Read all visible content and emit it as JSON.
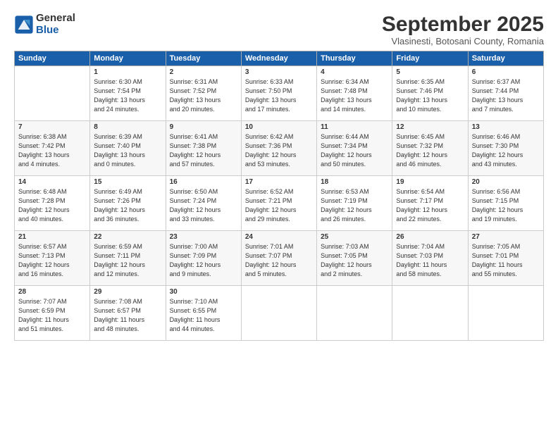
{
  "logo": {
    "general": "General",
    "blue": "Blue"
  },
  "title": "September 2025",
  "location": "Vlasinesti, Botosani County, Romania",
  "headers": [
    "Sunday",
    "Monday",
    "Tuesday",
    "Wednesday",
    "Thursday",
    "Friday",
    "Saturday"
  ],
  "weeks": [
    [
      {
        "day": "",
        "info": ""
      },
      {
        "day": "1",
        "info": "Sunrise: 6:30 AM\nSunset: 7:54 PM\nDaylight: 13 hours\nand 24 minutes."
      },
      {
        "day": "2",
        "info": "Sunrise: 6:31 AM\nSunset: 7:52 PM\nDaylight: 13 hours\nand 20 minutes."
      },
      {
        "day": "3",
        "info": "Sunrise: 6:33 AM\nSunset: 7:50 PM\nDaylight: 13 hours\nand 17 minutes."
      },
      {
        "day": "4",
        "info": "Sunrise: 6:34 AM\nSunset: 7:48 PM\nDaylight: 13 hours\nand 14 minutes."
      },
      {
        "day": "5",
        "info": "Sunrise: 6:35 AM\nSunset: 7:46 PM\nDaylight: 13 hours\nand 10 minutes."
      },
      {
        "day": "6",
        "info": "Sunrise: 6:37 AM\nSunset: 7:44 PM\nDaylight: 13 hours\nand 7 minutes."
      }
    ],
    [
      {
        "day": "7",
        "info": "Sunrise: 6:38 AM\nSunset: 7:42 PM\nDaylight: 13 hours\nand 4 minutes."
      },
      {
        "day": "8",
        "info": "Sunrise: 6:39 AM\nSunset: 7:40 PM\nDaylight: 13 hours\nand 0 minutes."
      },
      {
        "day": "9",
        "info": "Sunrise: 6:41 AM\nSunset: 7:38 PM\nDaylight: 12 hours\nand 57 minutes."
      },
      {
        "day": "10",
        "info": "Sunrise: 6:42 AM\nSunset: 7:36 PM\nDaylight: 12 hours\nand 53 minutes."
      },
      {
        "day": "11",
        "info": "Sunrise: 6:44 AM\nSunset: 7:34 PM\nDaylight: 12 hours\nand 50 minutes."
      },
      {
        "day": "12",
        "info": "Sunrise: 6:45 AM\nSunset: 7:32 PM\nDaylight: 12 hours\nand 46 minutes."
      },
      {
        "day": "13",
        "info": "Sunrise: 6:46 AM\nSunset: 7:30 PM\nDaylight: 12 hours\nand 43 minutes."
      }
    ],
    [
      {
        "day": "14",
        "info": "Sunrise: 6:48 AM\nSunset: 7:28 PM\nDaylight: 12 hours\nand 40 minutes."
      },
      {
        "day": "15",
        "info": "Sunrise: 6:49 AM\nSunset: 7:26 PM\nDaylight: 12 hours\nand 36 minutes."
      },
      {
        "day": "16",
        "info": "Sunrise: 6:50 AM\nSunset: 7:24 PM\nDaylight: 12 hours\nand 33 minutes."
      },
      {
        "day": "17",
        "info": "Sunrise: 6:52 AM\nSunset: 7:21 PM\nDaylight: 12 hours\nand 29 minutes."
      },
      {
        "day": "18",
        "info": "Sunrise: 6:53 AM\nSunset: 7:19 PM\nDaylight: 12 hours\nand 26 minutes."
      },
      {
        "day": "19",
        "info": "Sunrise: 6:54 AM\nSunset: 7:17 PM\nDaylight: 12 hours\nand 22 minutes."
      },
      {
        "day": "20",
        "info": "Sunrise: 6:56 AM\nSunset: 7:15 PM\nDaylight: 12 hours\nand 19 minutes."
      }
    ],
    [
      {
        "day": "21",
        "info": "Sunrise: 6:57 AM\nSunset: 7:13 PM\nDaylight: 12 hours\nand 16 minutes."
      },
      {
        "day": "22",
        "info": "Sunrise: 6:59 AM\nSunset: 7:11 PM\nDaylight: 12 hours\nand 12 minutes."
      },
      {
        "day": "23",
        "info": "Sunrise: 7:00 AM\nSunset: 7:09 PM\nDaylight: 12 hours\nand 9 minutes."
      },
      {
        "day": "24",
        "info": "Sunrise: 7:01 AM\nSunset: 7:07 PM\nDaylight: 12 hours\nand 5 minutes."
      },
      {
        "day": "25",
        "info": "Sunrise: 7:03 AM\nSunset: 7:05 PM\nDaylight: 12 hours\nand 2 minutes."
      },
      {
        "day": "26",
        "info": "Sunrise: 7:04 AM\nSunset: 7:03 PM\nDaylight: 11 hours\nand 58 minutes."
      },
      {
        "day": "27",
        "info": "Sunrise: 7:05 AM\nSunset: 7:01 PM\nDaylight: 11 hours\nand 55 minutes."
      }
    ],
    [
      {
        "day": "28",
        "info": "Sunrise: 7:07 AM\nSunset: 6:59 PM\nDaylight: 11 hours\nand 51 minutes."
      },
      {
        "day": "29",
        "info": "Sunrise: 7:08 AM\nSunset: 6:57 PM\nDaylight: 11 hours\nand 48 minutes."
      },
      {
        "day": "30",
        "info": "Sunrise: 7:10 AM\nSunset: 6:55 PM\nDaylight: 11 hours\nand 44 minutes."
      },
      {
        "day": "",
        "info": ""
      },
      {
        "day": "",
        "info": ""
      },
      {
        "day": "",
        "info": ""
      },
      {
        "day": "",
        "info": ""
      }
    ]
  ]
}
